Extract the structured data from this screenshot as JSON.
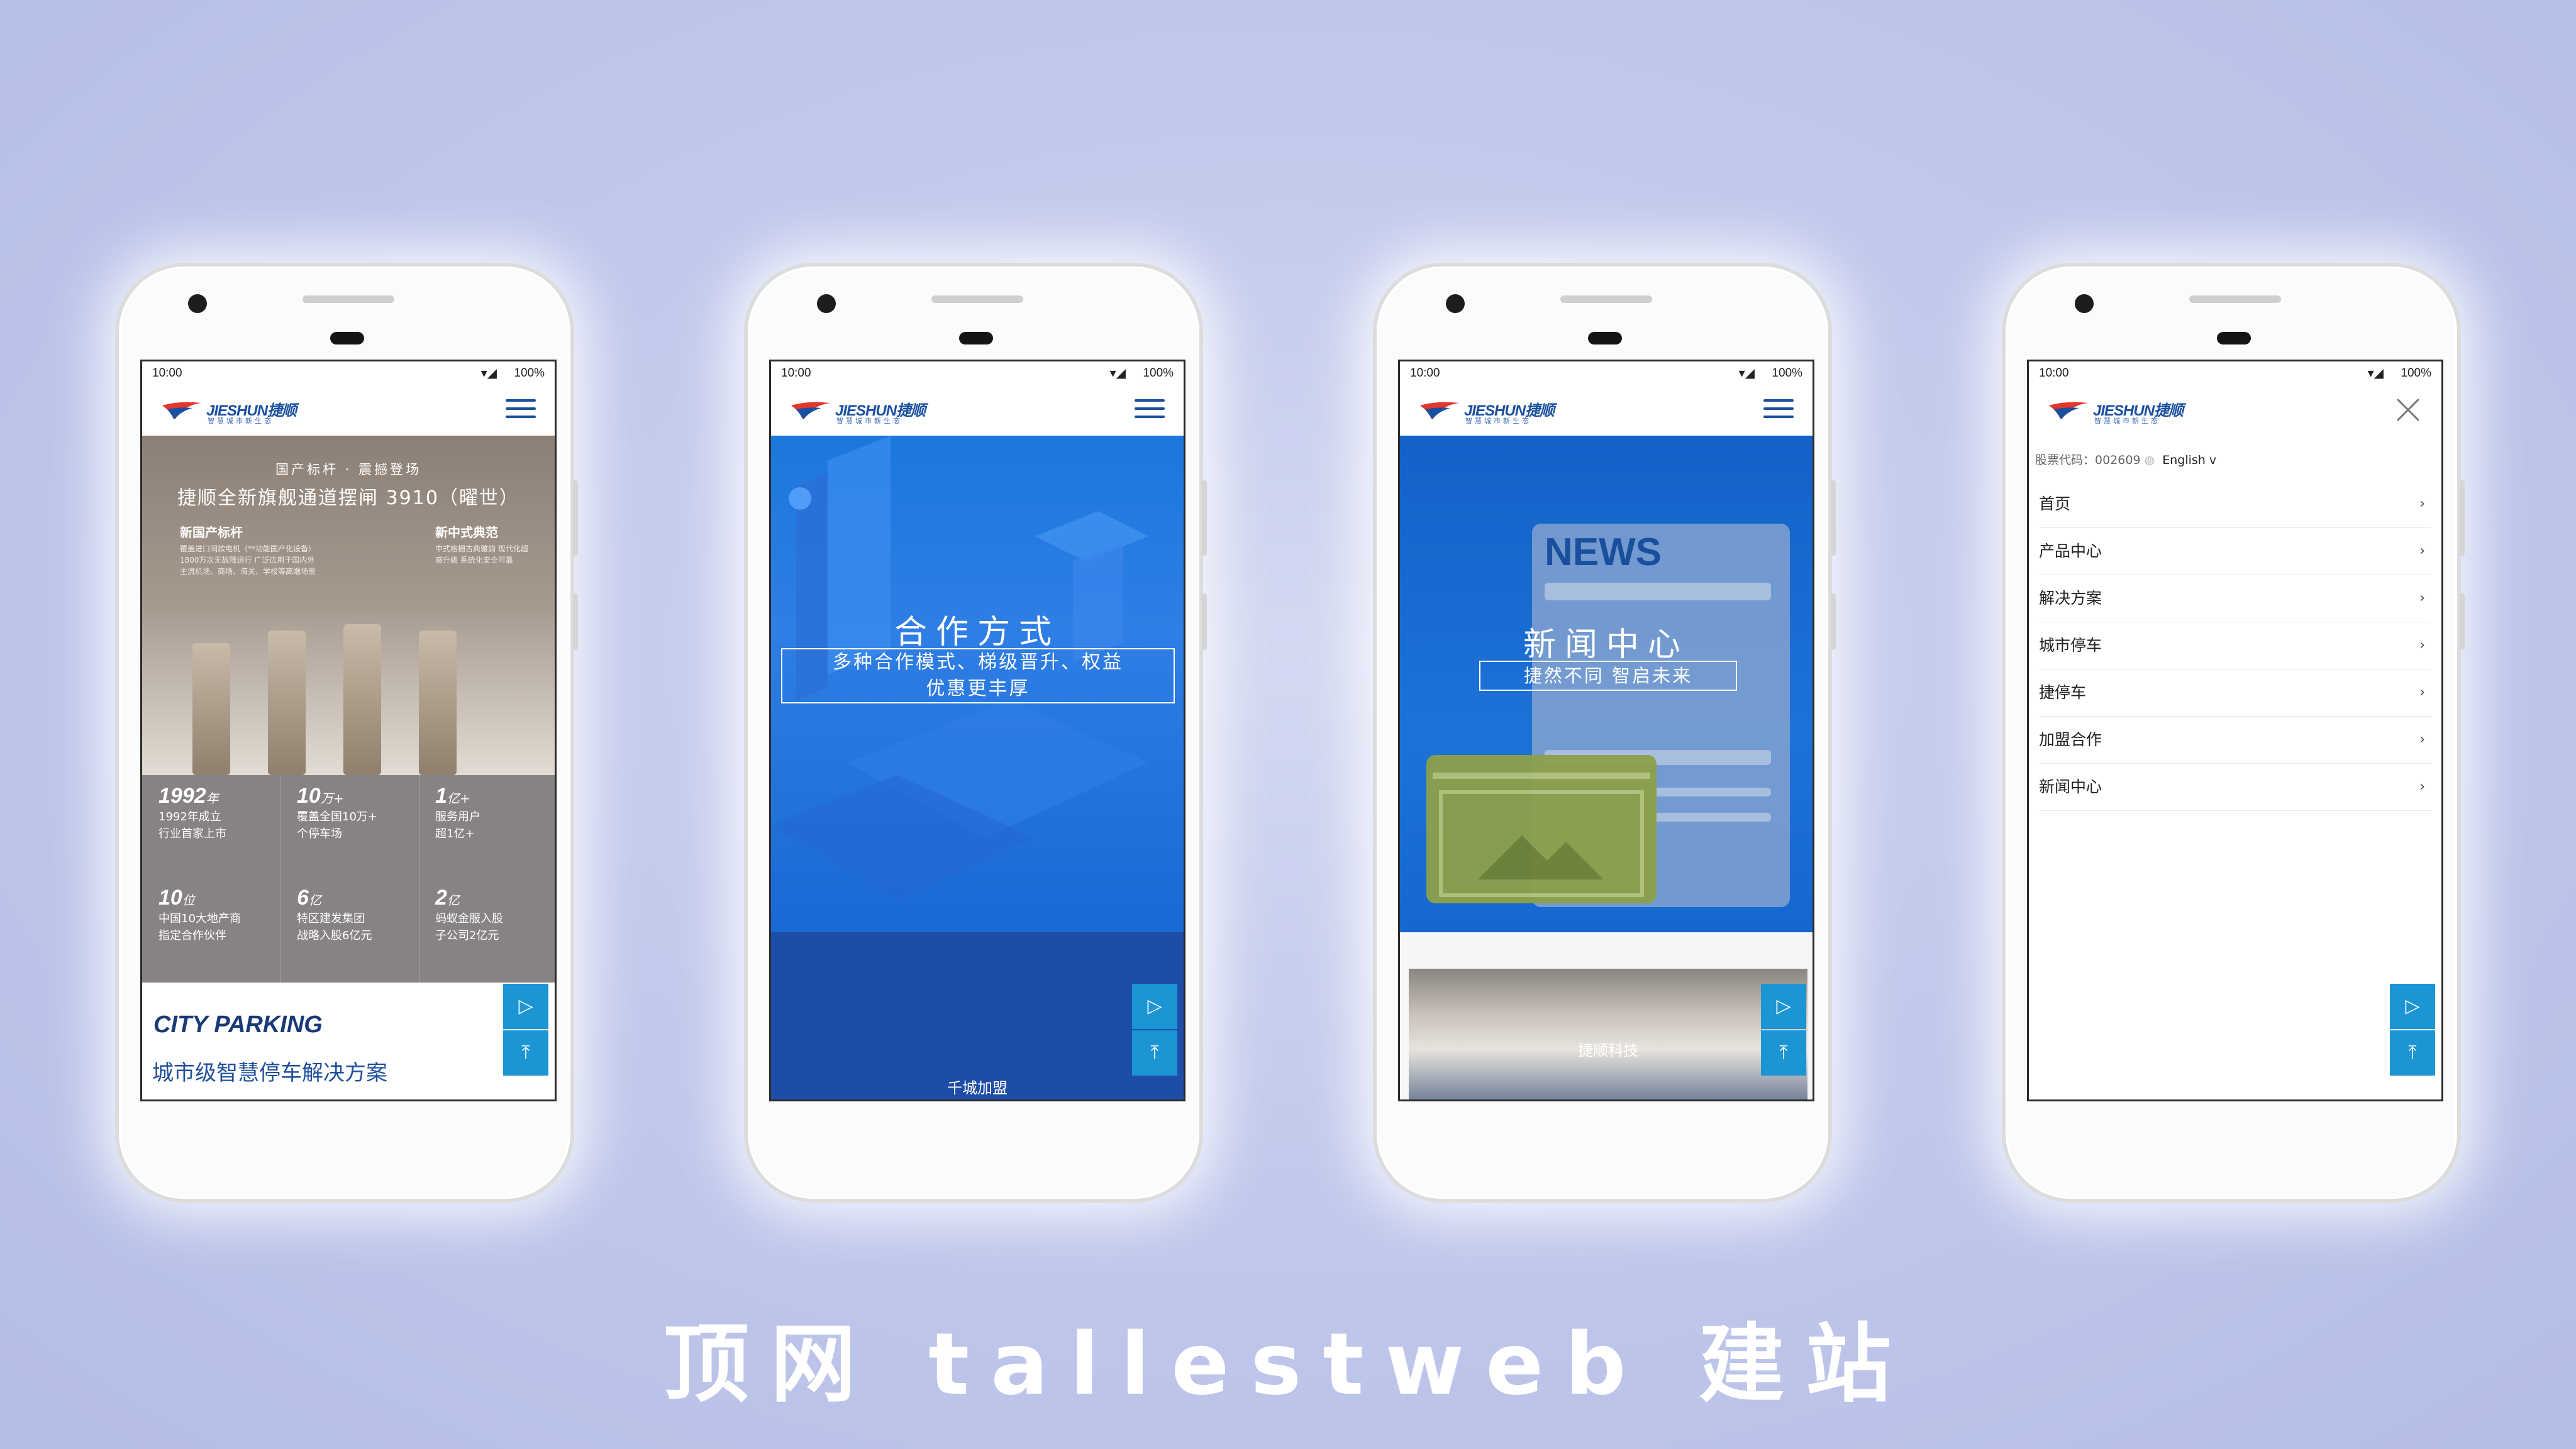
{
  "status_bar": {
    "time": "10:00",
    "battery": "100%"
  },
  "logo": {
    "brand": "JIESHUN捷顺",
    "slogan": "智慧城市新生态"
  },
  "phone1": {
    "hero_subtitle": "国产标杆 · 震撼登场",
    "hero_title": "捷顺全新旗舰通道摆闸 3910（曜世）",
    "feature_left_title": "新国产标杆",
    "feature_left_text": "覆盖进口同款电机（**功能国产化设备）1800万次无故障运行 广泛应用于国内外主流机场、商场、海关、学校等高端场景",
    "feature_right_title": "新中式典范",
    "feature_right_text": "中式格栅古典雅韵 现代化超感升级 系统化安全可靠",
    "stats": [
      {
        "num": "1992",
        "unit": "年",
        "lines": [
          "1992年成立",
          "行业首家上市"
        ]
      },
      {
        "num": "10",
        "unit": "万+",
        "lines": [
          "覆盖全国10万+",
          "个停车场"
        ]
      },
      {
        "num": "1",
        "unit": "亿+",
        "lines": [
          "服务用户",
          "超1亿+"
        ]
      },
      {
        "num": "10",
        "unit": "位",
        "lines": [
          "中国10大地产商",
          "指定合作伙伴"
        ]
      },
      {
        "num": "6",
        "unit": "亿",
        "lines": [
          "特区建发集团",
          "战略入股6亿元"
        ]
      },
      {
        "num": "2",
        "unit": "亿",
        "lines": [
          "蚂蚁金服入股",
          "子公司2亿元"
        ]
      }
    ],
    "section_title": "CITY PARKING",
    "section_subtitle": "城市级智慧停车解决方案"
  },
  "phone2": {
    "hero_title": "合作方式",
    "hero_box_line1": "多种合作模式、梯级晋升、权益",
    "hero_box_line2": "优惠更丰厚",
    "bottom_link": "千城加盟"
  },
  "phone3": {
    "news_label": "NEWS",
    "hero_title": "新闻中心",
    "hero_box": "捷然不同 智启未来",
    "photo_banner": "捷顺科技"
  },
  "phone4": {
    "stock_label": "股票代码：002609",
    "language": "English v",
    "nav_items": [
      "首页",
      "产品中心",
      "解决方案",
      "城市停车",
      "捷停车",
      "加盟合作",
      "新闻中心"
    ]
  },
  "float_buttons": {
    "play": "▷",
    "top": "⤒"
  },
  "watermark": "顶网 tallestweb 建站",
  "colors": {
    "brand_blue": "#1a4fa0",
    "float_button": "#1c95d4",
    "hero_blue": "#1b78dc"
  }
}
